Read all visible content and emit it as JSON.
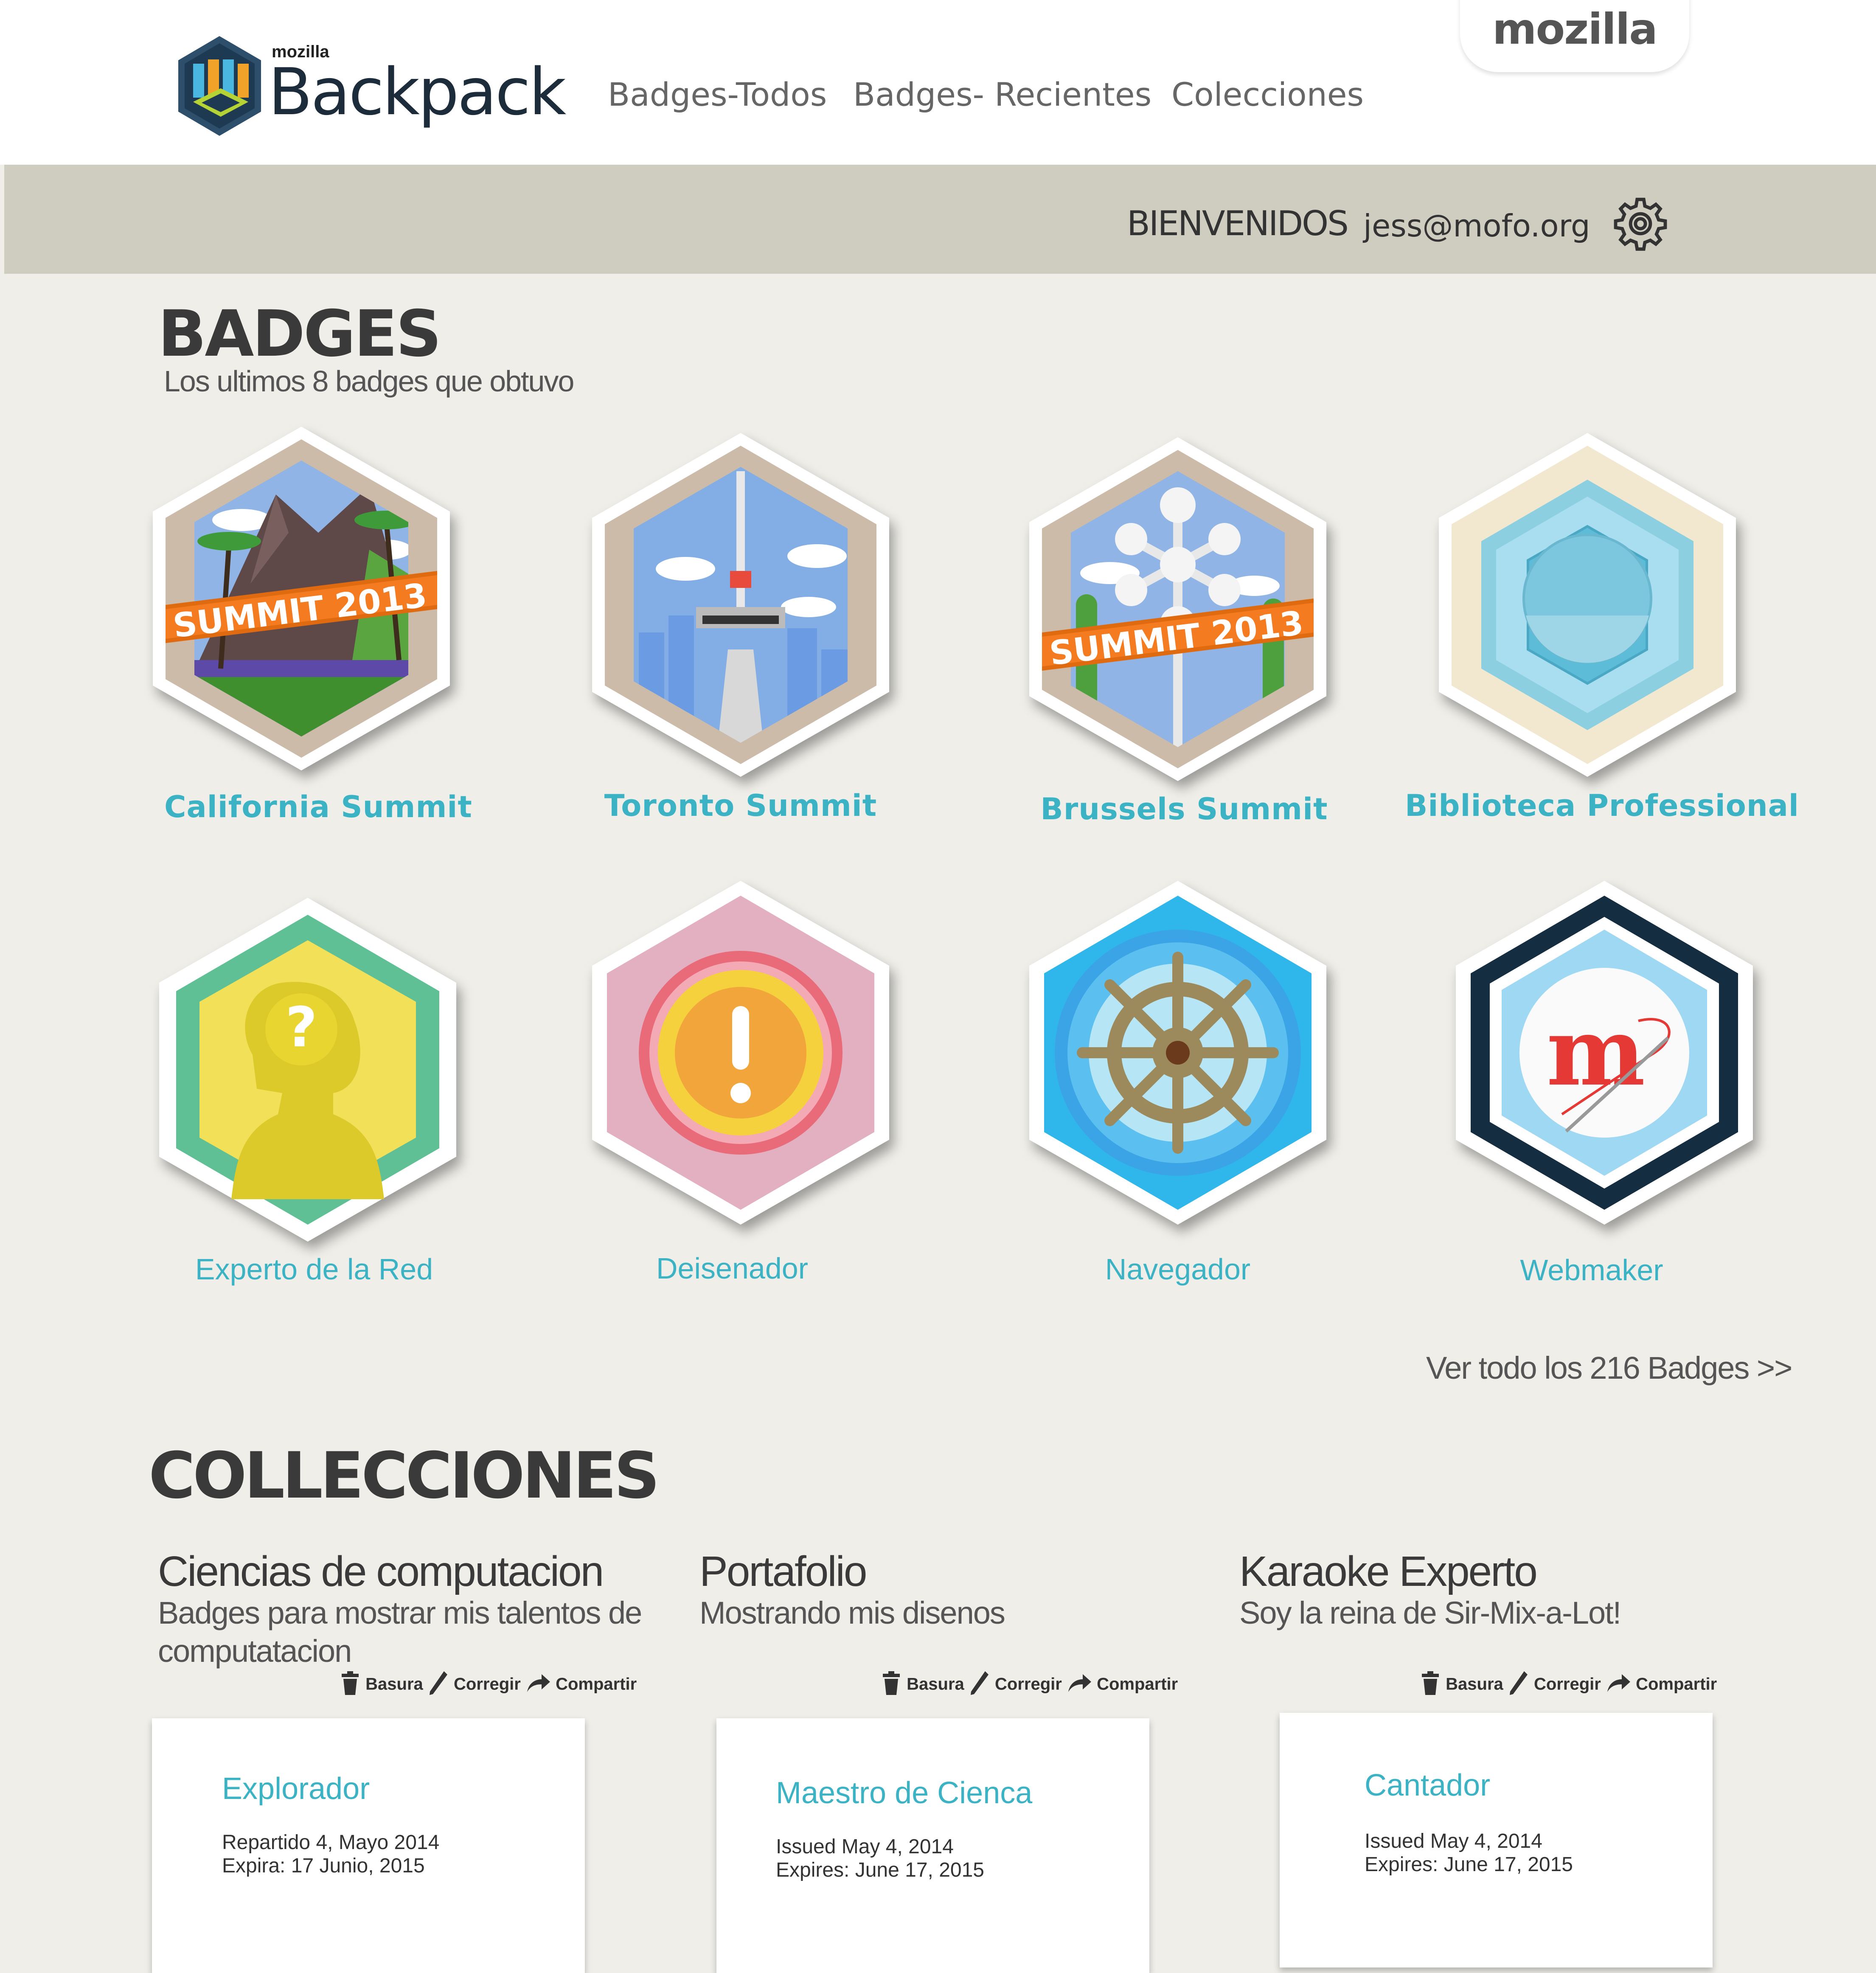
{
  "header": {
    "mozilla_tab": "mozilla",
    "logo_small": "mozilla",
    "logo_big": "Backpack",
    "nav": [
      "Badges-Todos",
      "Badges- Recientes",
      "Colecciones"
    ]
  },
  "welcome": {
    "label": "BIENVENIDOS",
    "email": "jess@mofo.org"
  },
  "badges": {
    "title": "BADGES",
    "subtitle": "Los ultimos 8 badges que obtuvo",
    "items": [
      {
        "label": "California Summit",
        "ribbon": "SUMMIT 2013"
      },
      {
        "label": "Toronto Summit"
      },
      {
        "label": "Brussels Summit",
        "ribbon": "SUMMIT 2013"
      },
      {
        "label": "Biblioteca Professional"
      },
      {
        "label": "Experto de la Red"
      },
      {
        "label": "Deisenador"
      },
      {
        "label": "Navegador"
      },
      {
        "label": "Webmaker"
      }
    ],
    "see_all": "Ver todo los 216 Badges >>"
  },
  "collections": {
    "title": "COLLECCIONES",
    "items": [
      {
        "title": "Ciencias de computacion",
        "desc": "Badges para mostrar mis talentos de computatacion",
        "actions": {
          "trash": "Basura",
          "edit": "Corregir",
          "share": "Compartir"
        },
        "card": {
          "title": "Explorador",
          "line1": "Repartido 4, Mayo 2014",
          "line2": "Expira: 17 Junio, 2015"
        }
      },
      {
        "title": "Portafolio",
        "desc": "Mostrando mis disenos",
        "actions": {
          "trash": "Basura",
          "edit": "Corregir",
          "share": "Compartir"
        },
        "card": {
          "title": "Maestro de Cienca",
          "line1": "Issued May 4, 2014",
          "line2": "Expires: June 17, 2015"
        }
      },
      {
        "title": "Karaoke Experto",
        "desc": "Soy la reina de Sir-Mix-a-Lot!",
        "actions": {
          "trash": "Basura",
          "edit": "Corregir",
          "share": "Compartir"
        },
        "card": {
          "title": "Cantador",
          "line1": "Issued May 4, 2014",
          "line2": "Expires: June 17, 2015"
        }
      }
    ]
  },
  "colors": {
    "accent": "#3bb3c5",
    "welcome_bar": "#cfccc0",
    "background": "#efeee9"
  },
  "icons": [
    "backpack-logo-icon",
    "gear-icon",
    "trash-icon",
    "pencil-icon",
    "share-icon"
  ]
}
